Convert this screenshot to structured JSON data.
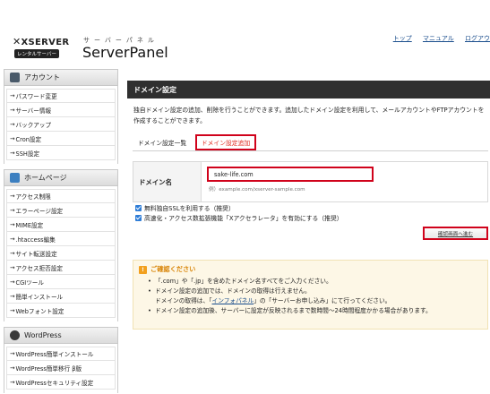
{
  "header": {
    "logo_brand": "XSERVER",
    "logo_badge": "レンタルサーバー",
    "logo_subtitle": "サーバーパネル",
    "logo_title": "ServerPanel",
    "links": [
      "トップ",
      "マニュアル",
      "ログアウ"
    ]
  },
  "sidebar": {
    "sections": [
      {
        "title": "アカウント",
        "icon": "account-icon",
        "items": [
          "パスワード変更",
          "サーバー情報",
          "バックアップ",
          "Cron設定",
          "SSH設定"
        ]
      },
      {
        "title": "ホームページ",
        "icon": "homepage-icon",
        "items": [
          "アクセス制限",
          "エラーページ設定",
          "MIME設定",
          ".htaccess編集",
          "サイト転送設定",
          "アクセス拒否設定",
          "CGIツール",
          "簡単インストール",
          "Webフォント設定"
        ]
      },
      {
        "title": "WordPress",
        "icon": "wordpress-icon",
        "items": [
          "WordPress簡単インストール",
          "WordPress簡単移行 β版",
          "WordPressセキュリティ設定"
        ]
      }
    ],
    "arrow": "→"
  },
  "main": {
    "title": "ドメイン設定",
    "description": "独自ドメイン設定の追加、削除を行うことができます。追加したドメイン設定を利用して、メールアカウントやFTPアカウントを作成することができます。",
    "tabs": [
      {
        "label": "ドメイン設定一覧",
        "active": false
      },
      {
        "label": "ドメイン設定追加",
        "active": true
      }
    ],
    "form": {
      "label": "ドメイン名",
      "value": "sake-life.com",
      "example": "例）example.com/xserver-sample.com"
    },
    "checkboxes": [
      {
        "label": "無料独自SSLを利用する（推奨）",
        "checked": true
      },
      {
        "label": "高速化・アクセス数拡張機能「Xアクセラレータ」を有効にする（推奨）",
        "checked": true
      }
    ],
    "confirm_button": "確認画面へ進む",
    "notice": {
      "title": "ご確認ください",
      "items": [
        "「.com」や「.jp」を含めたドメイン名すべてをご入力ください。",
        "ドメイン設定の追加では、ドメインの取得は行えません。",
        "ドメイン設定の追加後、サーバーに設定が反映されるまで数時間〜24時間程度かかる場合があります。"
      ],
      "sub_line": {
        "before": "ドメインの取得は、「",
        "link": "インフォパネル",
        "after": "」の「サーバーお申し込み」にて行ってください。"
      }
    }
  },
  "colors": {
    "highlight_red": "#d0021b",
    "title_bar": "#2f2f2f",
    "notice_bg": "#fdf7e6",
    "notice_title": "#d9860a",
    "link": "#1a4d8c"
  }
}
